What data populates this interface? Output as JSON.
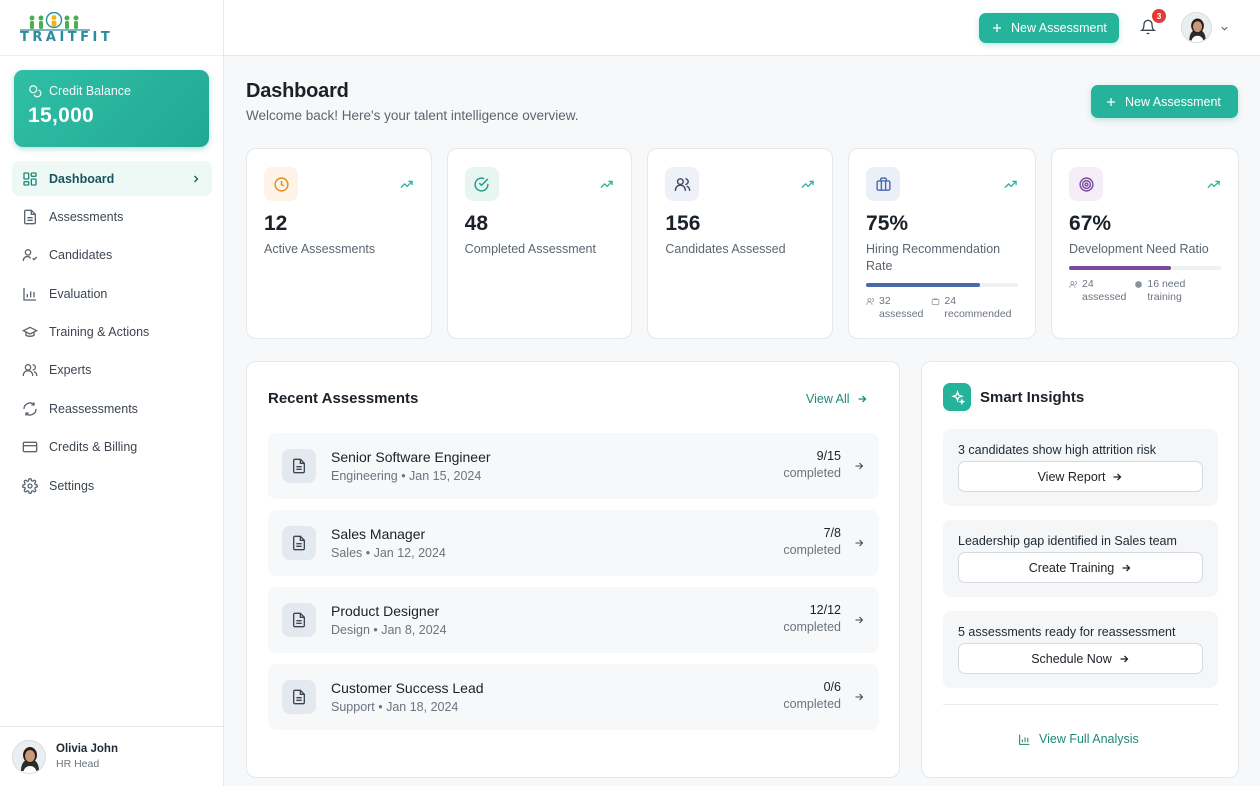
{
  "brand": {
    "name": "TRAITFIT",
    "accent": "#26b39b"
  },
  "credit": {
    "label": "Credit Balance",
    "value": "15,000"
  },
  "nav": [
    {
      "label": "Dashboard",
      "icon": "grid-icon",
      "active": true
    },
    {
      "label": "Assessments",
      "icon": "document-icon"
    },
    {
      "label": "Candidates",
      "icon": "user-check-icon"
    },
    {
      "label": "Evaluation",
      "icon": "bar-chart-icon"
    },
    {
      "label": "Training & Actions",
      "icon": "graduation-cap-icon"
    },
    {
      "label": "Experts",
      "icon": "users-icon"
    },
    {
      "label": "Reassessments",
      "icon": "refresh-icon"
    },
    {
      "label": "Credits & Billing",
      "icon": "credit-card-icon"
    },
    {
      "label": "Settings",
      "icon": "gear-icon"
    }
  ],
  "user": {
    "name": "Olivia John",
    "role": "HR Head"
  },
  "topbar": {
    "new_label": "New Assessment",
    "notifications": "3"
  },
  "page": {
    "title": "Dashboard",
    "subtitle": "Welcome back! Here's your talent intelligence overview.",
    "new_label": "New Assessment"
  },
  "stats": [
    {
      "value": "12",
      "label": "Active Assessments",
      "icon": "clock-icon",
      "icon_bg": "#fdf3e6",
      "icon_color": "#e08a1e"
    },
    {
      "value": "48",
      "label": "Completed Assessment",
      "icon": "check-circle-icon",
      "icon_bg": "#e8f6f2",
      "icon_color": "#1e9a84"
    },
    {
      "value": "156",
      "label": "Candidates Assessed",
      "icon": "users-icon",
      "icon_bg": "#eef1f7",
      "icon_color": "#3b4a66"
    },
    {
      "value": "75%",
      "label": "Hiring Recommendation Rate",
      "icon": "briefcase-icon",
      "icon_bg": "#eaeff8",
      "icon_color": "#4a68a8",
      "progress": 0.75,
      "bar_color": "#4a68a8",
      "mini": [
        {
          "num": "32",
          "text": "assessed"
        },
        {
          "num": "24",
          "text": "recommended"
        }
      ]
    },
    {
      "value": "67%",
      "label": "Development Need Ratio",
      "icon": "target-icon",
      "icon_bg": "#f4eef8",
      "icon_color": "#7b4a9c",
      "progress": 0.67,
      "bar_color": "#7b4a9c",
      "mini": [
        {
          "num": "24",
          "text": "assessed"
        },
        {
          "num": "16 need",
          "text": "training"
        }
      ]
    }
  ],
  "recent": {
    "title": "Recent Assessments",
    "view_all": "View All",
    "items": [
      {
        "title": "Senior Software Engineer",
        "meta": "Engineering • Jan 15, 2024",
        "count": "9/15",
        "count_label": "completed"
      },
      {
        "title": "Sales Manager",
        "meta": "Sales • Jan 12, 2024",
        "count": "7/8",
        "count_label": "completed"
      },
      {
        "title": "Product Designer",
        "meta": "Design • Jan 8, 2024",
        "count": "12/12",
        "count_label": "completed"
      },
      {
        "title": "Customer Success Lead",
        "meta": "Support • Jan 18, 2024",
        "count": "0/6",
        "count_label": "completed"
      }
    ]
  },
  "insights": {
    "title": "Smart Insights",
    "items": [
      {
        "text": "3 candidates show high attrition risk",
        "action": "View Report"
      },
      {
        "text": "Leadership gap identified in Sales team",
        "action": "Create Training"
      },
      {
        "text": "5 assessments ready for reassessment",
        "action": "Schedule Now"
      }
    ],
    "full_analysis": "View Full Analysis"
  }
}
